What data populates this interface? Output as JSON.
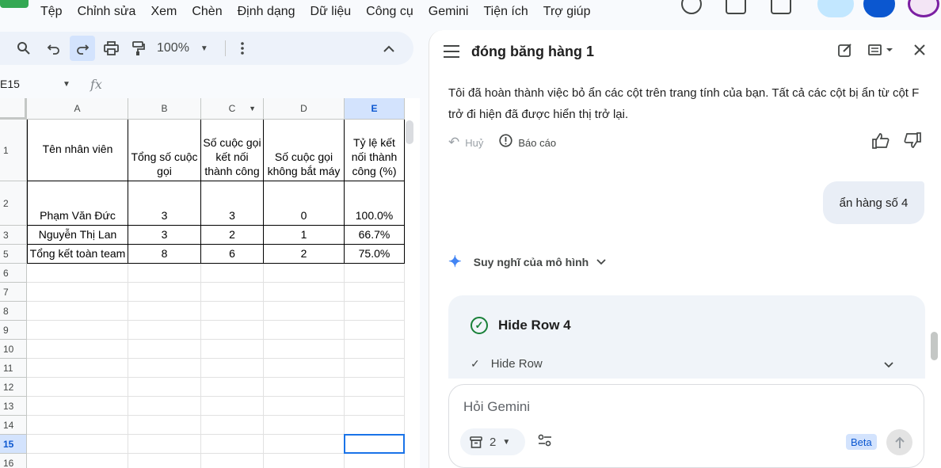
{
  "menu": [
    "Tệp",
    "Chỉnh sửa",
    "Xem",
    "Chèn",
    "Định dạng",
    "Dữ liệu",
    "Công cụ",
    "Gemini",
    "Tiện ích",
    "Trợ giúp"
  ],
  "toolbar": {
    "zoom": "100%"
  },
  "formula": {
    "cell_ref": "E15",
    "fx": "fx"
  },
  "sheet": {
    "columns": [
      "A",
      "B",
      "C",
      "D",
      "E"
    ],
    "row_numbers": [
      "1",
      "2",
      "3",
      "5",
      "6",
      "7",
      "8",
      "9",
      "10",
      "11",
      "12",
      "13",
      "14",
      "15",
      "16"
    ],
    "headers": [
      "Tên nhân viên",
      "Tổng số cuộc gọi",
      "Số cuộc gọi kết nối thành công",
      "Số cuộc gọi không bắt máy",
      "Tỷ lệ kết nối thành công (%)"
    ],
    "rows": [
      [
        "Phạm Văn Đức",
        "3",
        "3",
        "0",
        "100.0%"
      ],
      [
        "Nguyễn Thị Lan",
        "3",
        "2",
        "1",
        "66.7%"
      ],
      [
        "Tổng kết toàn team",
        "8",
        "6",
        "2",
        "75.0%"
      ]
    ],
    "selected_cell": "E15"
  },
  "panel": {
    "title": "đóng băng hàng 1",
    "assistant_message": "Tôi đã hoàn thành việc bỏ ẩn các cột trên trang tính của bạn. Tất cả các cột bị ẩn từ cột F trở đi hiện đã được hiển thị trở lại.",
    "undo_label": "Huỷ",
    "report_label": "Báo cáo",
    "user_message": "ẩn hàng số 4",
    "thinking_label": "Suy nghĩ của mô hình",
    "tool_title": "Hide Row 4",
    "tool_step": "Hide Row",
    "input_placeholder": "Hỏi Gemini",
    "chip_count": "2",
    "beta_label": "Beta"
  },
  "icons": {
    "search": "search-icon",
    "undo": "undo-icon",
    "redo": "redo-icon",
    "print": "print-icon",
    "paint_format": "paint-format-icon",
    "more": "more-vert-icon",
    "collapse": "chevron-up-icon",
    "menu": "hamburger-icon",
    "edit": "edit-icon",
    "view": "view-mode-icon",
    "close": "close-icon",
    "thumb_up": "thumb-up-icon",
    "thumb_down": "thumb-down-icon",
    "spark": "gemini-spark-icon",
    "check": "check-circle-icon",
    "send": "send-icon"
  },
  "colors": {
    "accent": "#0b57d0",
    "selection": "#1a73e8",
    "success": "#188038",
    "toolbar_bg": "#edf2fa"
  }
}
